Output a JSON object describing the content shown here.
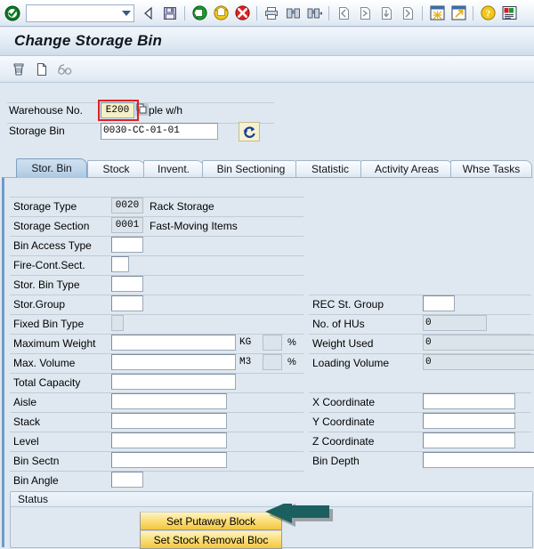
{
  "window": {
    "title": "Change Storage Bin"
  },
  "toolbar": {
    "command_field_value": "",
    "icons": [
      {
        "name": "enter-check-icon",
        "glyph": "check-circle"
      },
      {
        "name": "back-icon",
        "glyph": "back-triangle"
      },
      {
        "name": "save-icon",
        "glyph": "floppy"
      },
      {
        "name": "back-green-icon",
        "glyph": "green-back"
      },
      {
        "name": "exit-yellow-icon",
        "glyph": "yellow-up"
      },
      {
        "name": "cancel-red-icon",
        "glyph": "red-x"
      },
      {
        "name": "print-icon",
        "glyph": "printer"
      },
      {
        "name": "find-icon",
        "glyph": "binoculars"
      },
      {
        "name": "find-next-icon",
        "glyph": "binoculars-plus"
      },
      {
        "name": "first-page-icon",
        "glyph": "page-first"
      },
      {
        "name": "previous-page-icon",
        "glyph": "page-prev"
      },
      {
        "name": "next-page-icon",
        "glyph": "page-next"
      },
      {
        "name": "last-page-icon",
        "glyph": "page-last"
      },
      {
        "name": "new-session-icon",
        "glyph": "new-window"
      },
      {
        "name": "create-shortcut-icon",
        "glyph": "shortcut-arrow"
      },
      {
        "name": "help-icon",
        "glyph": "question-mark"
      },
      {
        "name": "customize-layout-icon",
        "glyph": "layout"
      }
    ]
  },
  "app_toolbar": {
    "icons": [
      {
        "name": "delete-icon",
        "glyph": "trash"
      },
      {
        "name": "new-document-icon",
        "glyph": "blank-page"
      },
      {
        "name": "display-glasses-icon",
        "glyph": "glasses"
      }
    ]
  },
  "header": {
    "warehouse_label": "Warehouse No.",
    "warehouse_value": "E200",
    "warehouse_text": "ple w/h",
    "storage_bin_label": "Storage Bin",
    "storage_bin_value": "0030-CC-01-01",
    "refresh_button_name": "refresh-icon"
  },
  "tabs": [
    {
      "label": "Stor. Bin",
      "active": true
    },
    {
      "label": "Stock",
      "active": false
    },
    {
      "label": "Invent.",
      "active": false
    },
    {
      "label": "Bin Sectioning",
      "active": false
    },
    {
      "label": "Statistic",
      "active": false
    },
    {
      "label": "Activity Areas",
      "active": false
    },
    {
      "label": "Whse Tasks",
      "active": false
    }
  ],
  "form": {
    "left": [
      {
        "label": "Storage Type",
        "value": "0020",
        "text": "Rack Storage",
        "readonly": true
      },
      {
        "label": "Storage Section",
        "value": "0001",
        "text": "Fast-Moving Items",
        "readonly": true
      },
      {
        "label": "Bin Access Type",
        "value": "",
        "text": "",
        "readonly": false
      },
      {
        "label": "Fire-Cont.Sect.",
        "value": "",
        "text": "",
        "readonly": false
      },
      {
        "label": "Stor. Bin Type",
        "value": "",
        "text": "",
        "readonly": false
      },
      {
        "label": "Stor.Group",
        "value": "",
        "text": "",
        "readonly": false
      },
      {
        "label": "Fixed Bin Type",
        "value": "",
        "text": "",
        "readonly": true
      },
      {
        "label": "Maximum Weight",
        "value": "",
        "unit": "KG",
        "percent": "%",
        "readonly": false
      },
      {
        "label": "Max. Volume",
        "value": "",
        "unit": "M3",
        "percent": "%",
        "readonly": false
      },
      {
        "label": "Total Capacity",
        "value": "",
        "text": "",
        "readonly": false
      },
      {
        "label": "Aisle",
        "value": "",
        "text": "",
        "readonly": false
      },
      {
        "label": "Stack",
        "value": "",
        "text": "",
        "readonly": false
      },
      {
        "label": "Level",
        "value": "",
        "text": "",
        "readonly": false
      },
      {
        "label": "Bin Sectn",
        "value": "",
        "text": "",
        "readonly": false
      },
      {
        "label": "Bin Angle",
        "value": "",
        "text": "",
        "readonly": false
      }
    ],
    "right": [
      {
        "label": "REC St. Group",
        "value": "",
        "readonly": false
      },
      {
        "label": "No. of HUs",
        "value": "0",
        "readonly": true
      },
      {
        "label": "Weight Used",
        "value": "0",
        "readonly": true
      },
      {
        "label": "Loading Volume",
        "value": "0",
        "readonly": true
      },
      {
        "label": "X Coordinate",
        "value": "",
        "readonly": false
      },
      {
        "label": "Y Coordinate",
        "value": "",
        "readonly": false
      },
      {
        "label": "Z Coordinate",
        "value": "",
        "readonly": false
      },
      {
        "label": "Bin Depth",
        "value": "",
        "readonly": false
      }
    ]
  },
  "status_group": {
    "title": "Status",
    "buttons": [
      {
        "label": "Set Putaway Block"
      },
      {
        "label": "Set Stock Removal Bloc"
      }
    ]
  },
  "annotations": {
    "highlight_color": "#e02020",
    "arrow_color": "#1c5f5f"
  }
}
